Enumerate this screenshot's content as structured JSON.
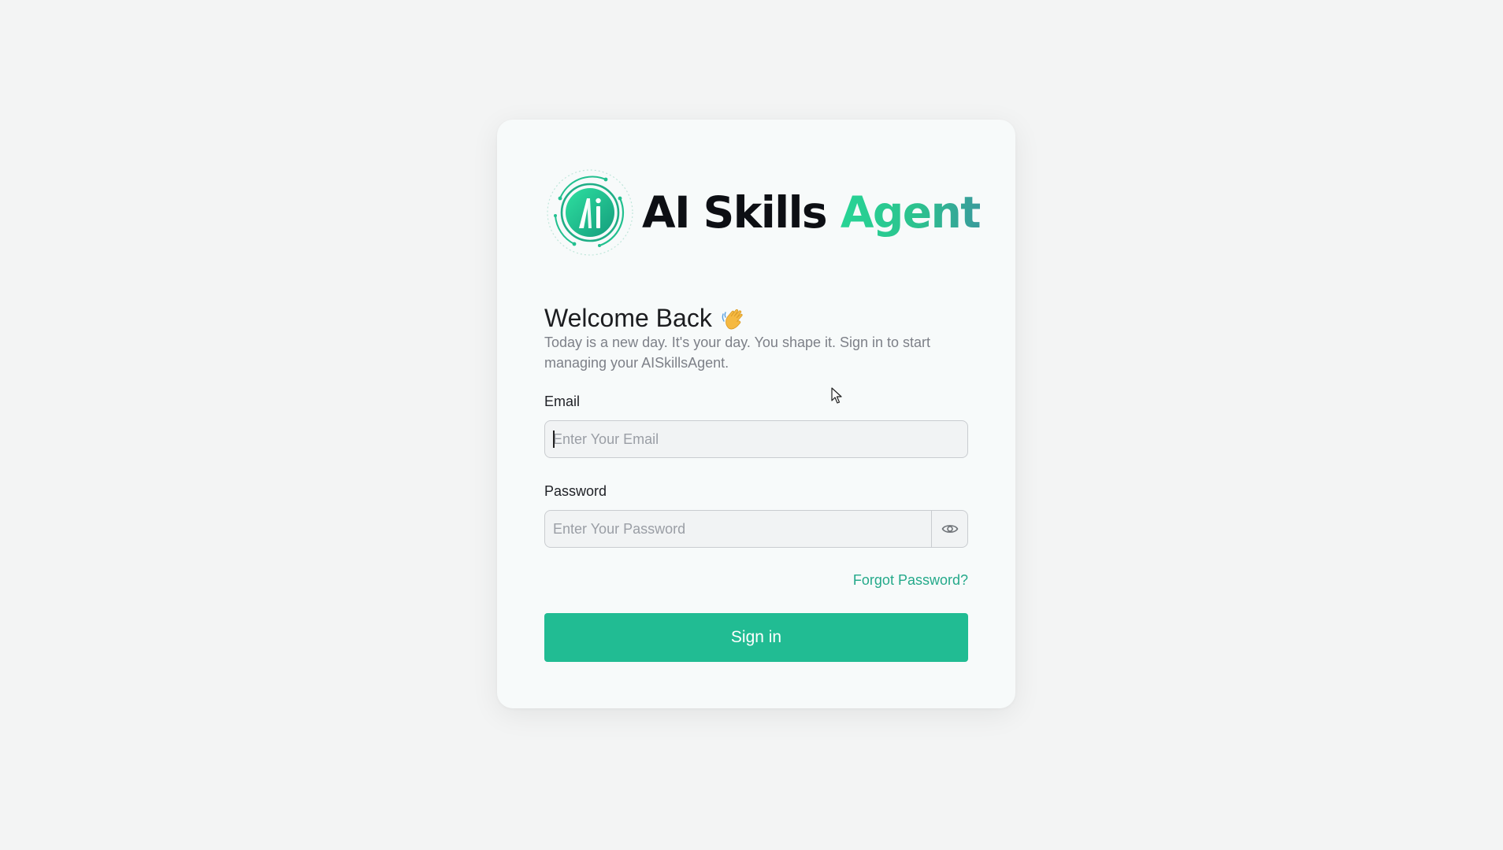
{
  "brand": {
    "name_part1": "AI Skills",
    "name_part2": "Agent",
    "logo_monogram": "Ai",
    "accent_color": "#21bc93",
    "gradient_end_color": "#3a9b9c"
  },
  "login": {
    "heading": "Welcome Back",
    "heading_emoji": "waving-hand-icon",
    "subtitle": "Today is a new day. It's your day. You shape it. Sign in to start managing your AISkillsAgent.",
    "email": {
      "label": "Email",
      "placeholder": "Enter Your Email",
      "value": ""
    },
    "password": {
      "label": "Password",
      "placeholder": "Enter Your Password",
      "value": "",
      "toggle_icon": "eye-icon"
    },
    "forgot_password": "Forgot Password?",
    "submit_label": "Sign in"
  },
  "colors": {
    "page_background": "#f3f4f4",
    "card_background": "#f7fafa",
    "link": "#24a98a",
    "button": "#21bc93"
  }
}
